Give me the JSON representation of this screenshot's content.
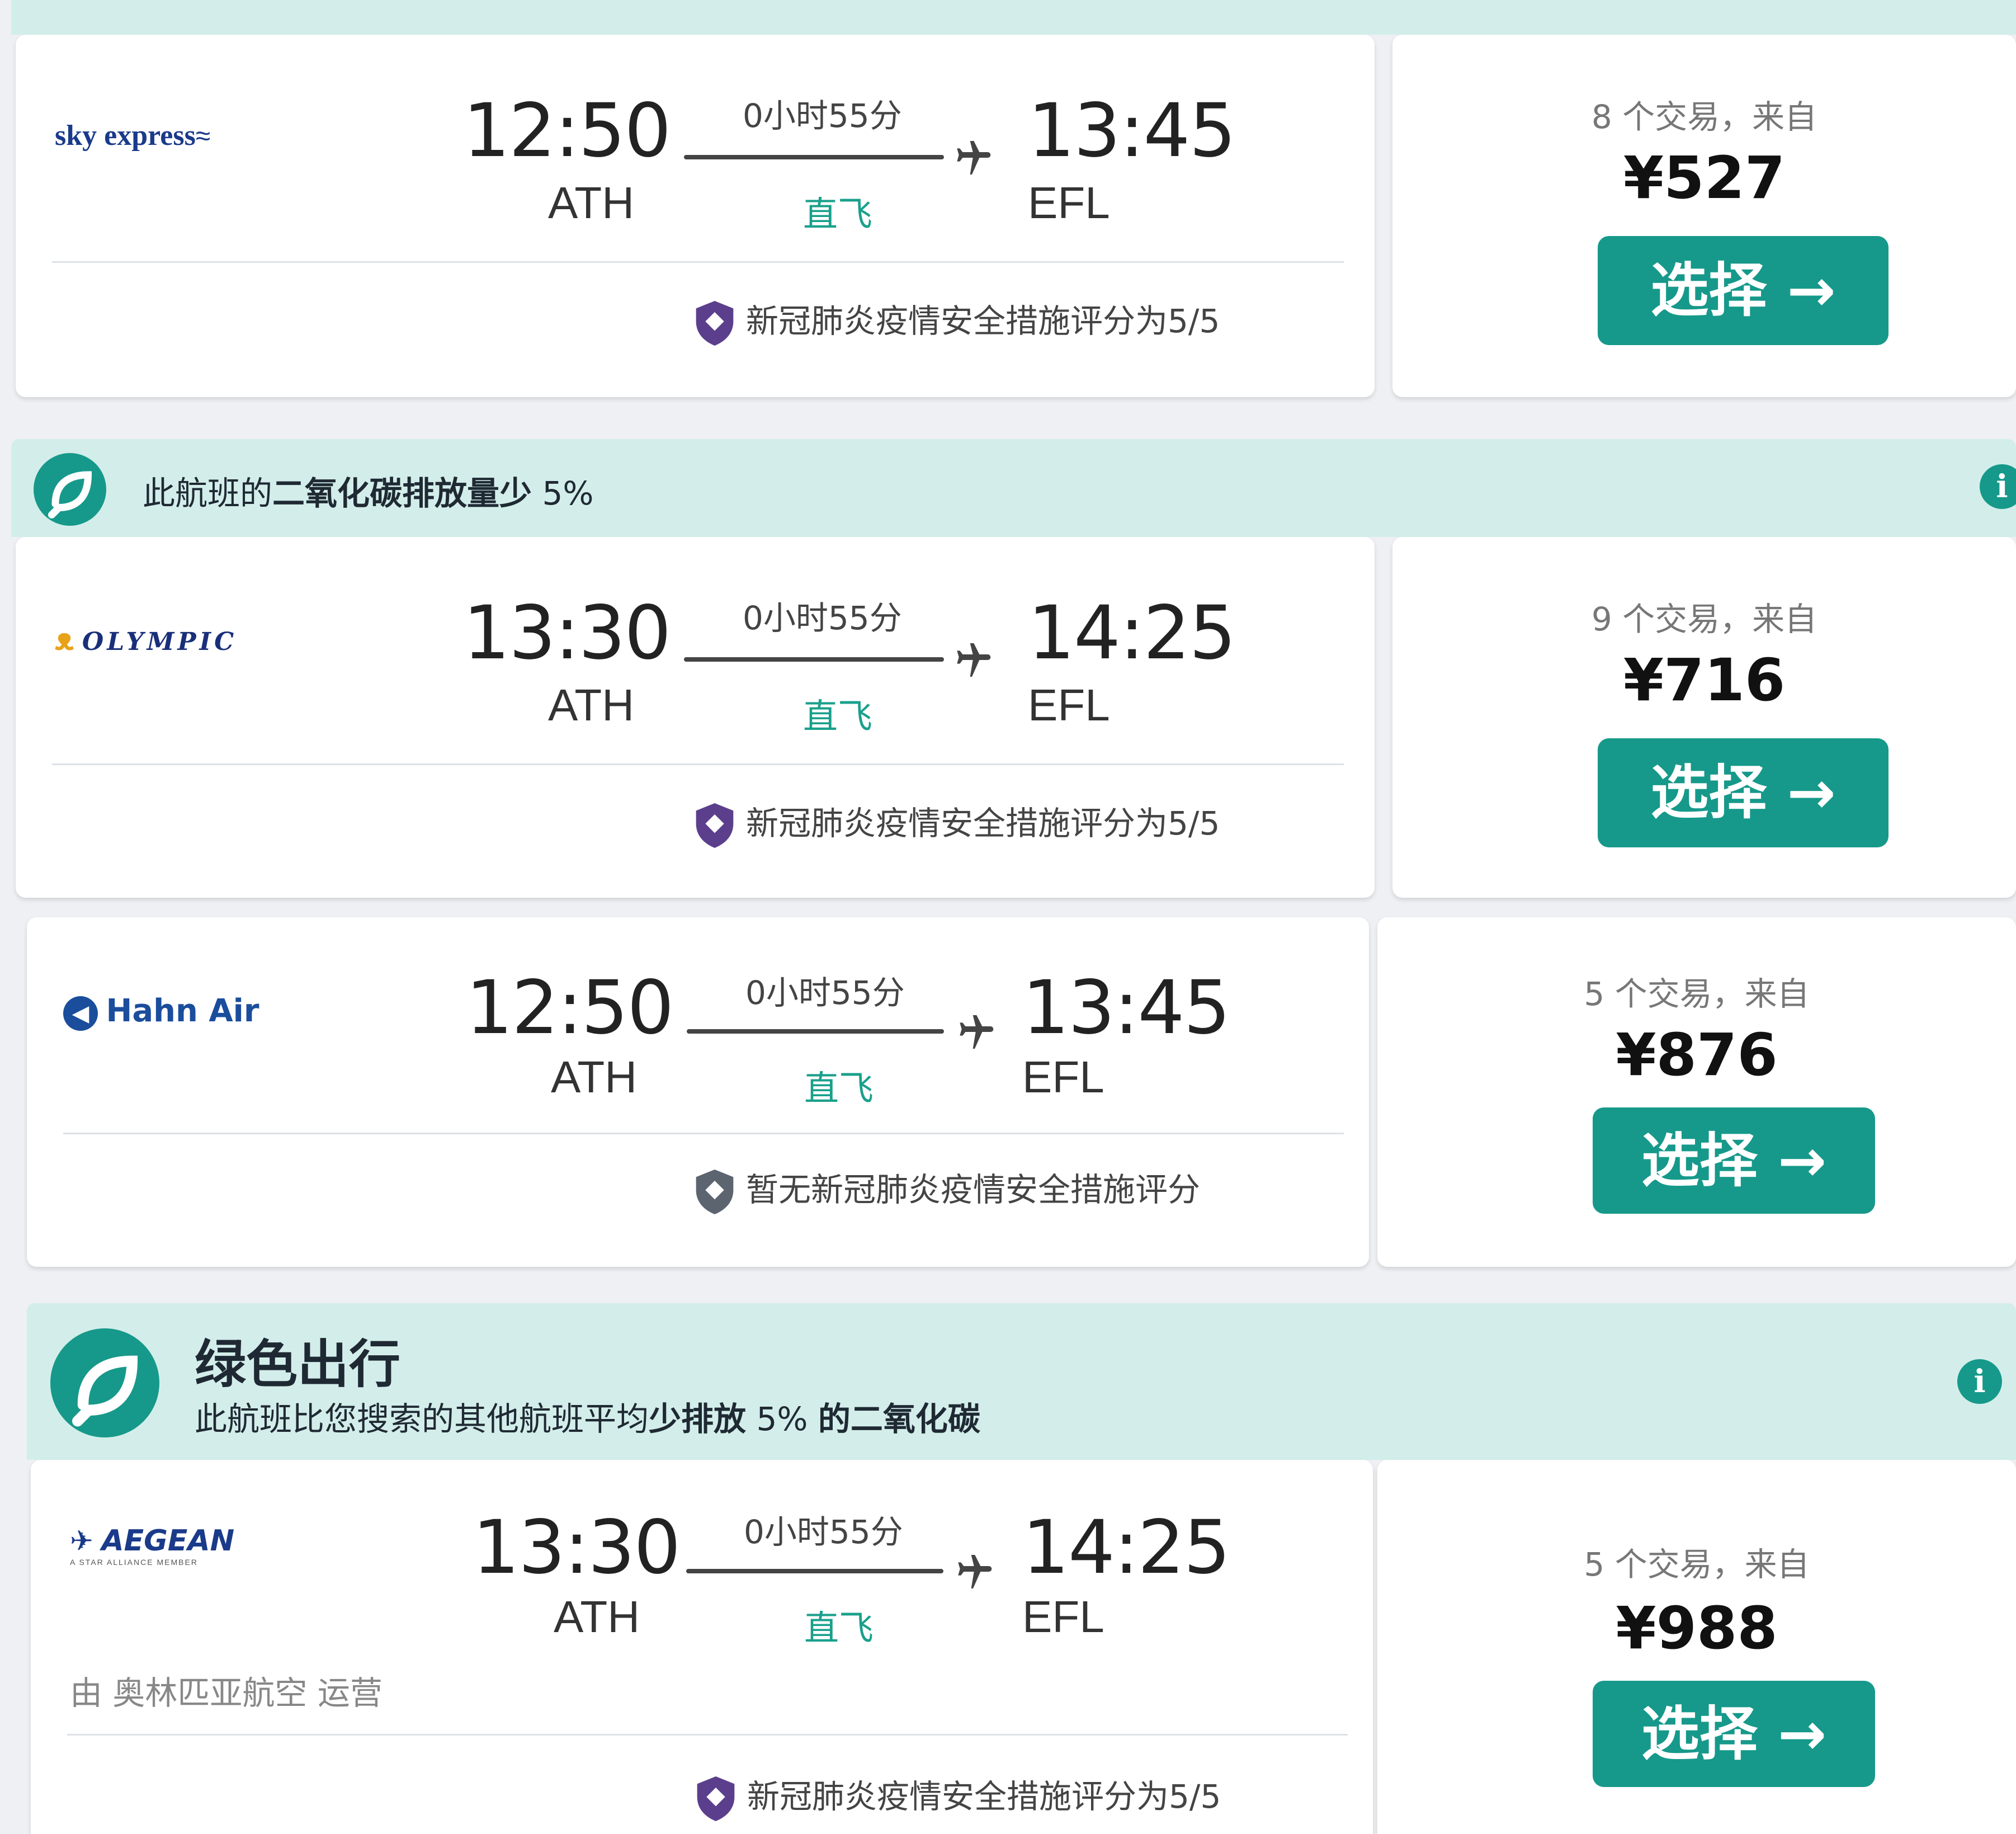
{
  "flights": [
    {
      "airline": "sky express",
      "depart_time": "12:50",
      "depart_airport": "ATH",
      "duration": "0小时55分",
      "stops": "直飞",
      "arrive_time": "13:45",
      "arrive_airport": "EFL",
      "covid_rating": "新冠肺炎疫情安全措施评分为5/5",
      "deals": "8 个交易，来自",
      "price": "¥527",
      "select_label": "选择 →"
    },
    {
      "airline": "OLYMPIC",
      "depart_time": "13:30",
      "depart_airport": "ATH",
      "duration": "0小时55分",
      "stops": "直飞",
      "arrive_time": "14:25",
      "arrive_airport": "EFL",
      "covid_rating": "新冠肺炎疫情安全措施评分为5/5",
      "deals": "9 个交易，来自",
      "price": "¥716",
      "select_label": "选择 →"
    },
    {
      "airline": "Hahn Air",
      "depart_time": "12:50",
      "depart_airport": "ATH",
      "duration": "0小时55分",
      "stops": "直飞",
      "arrive_time": "13:45",
      "arrive_airport": "EFL",
      "covid_rating": "暂无新冠肺炎疫情安全措施评分",
      "deals": "5 个交易，来自",
      "price": "¥876",
      "select_label": "选择 →"
    },
    {
      "airline": "AEGEAN",
      "airline_sub": "A STAR ALLIANCE MEMBER",
      "depart_time": "13:30",
      "depart_airport": "ATH",
      "duration": "0小时55分",
      "stops": "直飞",
      "arrive_time": "14:25",
      "arrive_airport": "EFL",
      "operated_by": "由 奥林匹亚航空 运营",
      "covid_rating": "新冠肺炎疫情安全措施评分为5/5",
      "deals": "5 个交易，来自",
      "price": "¥988",
      "select_label": "选择 →"
    }
  ],
  "co2_banner": {
    "text_prefix": "此航班的",
    "text_bold": "二氧化碳排放量少",
    "text_suffix": " 5%"
  },
  "green_banner": {
    "title": "绿色出行",
    "text_prefix": "此航班比您搜索的其他航班平均",
    "text_bold1": "少排放",
    "text_mid": " 5% ",
    "text_bold2": "的二氧化碳"
  },
  "info_icon": "i",
  "colors": {
    "accent": "#16998a",
    "banner_bg": "#d3eeea",
    "nonstop_text": "#1aa08c",
    "shield_purple": "#5b3f8c",
    "shield_gray": "#5c6470"
  }
}
